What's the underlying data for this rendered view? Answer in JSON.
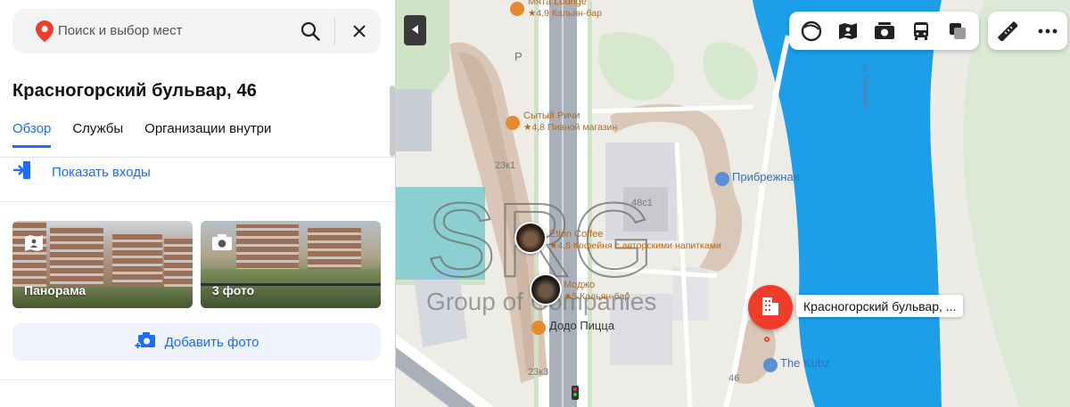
{
  "search": {
    "placeholder": "Поиск и выбор мест"
  },
  "place": {
    "title": "Красногорский бульвар, 46"
  },
  "tabs": [
    {
      "label": "Обзор",
      "active": true
    },
    {
      "label": "Службы",
      "active": false
    },
    {
      "label": "Организации внутри",
      "active": false
    }
  ],
  "entrances": {
    "label": "Показать входы"
  },
  "media": {
    "panorama_label": "Панорама",
    "photos_label": "3 фото"
  },
  "add_photo": {
    "label": "Добавить фото"
  },
  "map": {
    "pois": {
      "myata": {
        "name": "Мята Lounge",
        "rating": "★4,9 Кальян-бар"
      },
      "rich": {
        "name": "Сытый Ричи",
        "rating": "★4,8 Пивной магазин"
      },
      "etion": {
        "name": "Etion Coffee",
        "rating": "★4,8 Кофейня с авторскими напитками"
      },
      "modzho": {
        "name": "Моджо",
        "rating": "★5 Кальян-бар"
      },
      "dodo": {
        "name": "Додо Пицца"
      },
      "pribrezhnaya": {
        "name": "Прибрежная"
      },
      "kubz": {
        "name": "The Kubz"
      }
    },
    "building_numbers": {
      "b23k1": "23к1",
      "b48c1": "48с1",
      "b23k3": "23к3",
      "b46": "46",
      "parking": "P"
    },
    "river_label": "р. Москва",
    "selected_label": "Красногорский бульвар, ...",
    "watermark": {
      "main": "SRG",
      "sub": "Group of Companies"
    }
  },
  "colors": {
    "accent": "#196dff",
    "marker": "#f03d2a",
    "water": "#1c9fe8",
    "poi_text": "#b4681e"
  }
}
